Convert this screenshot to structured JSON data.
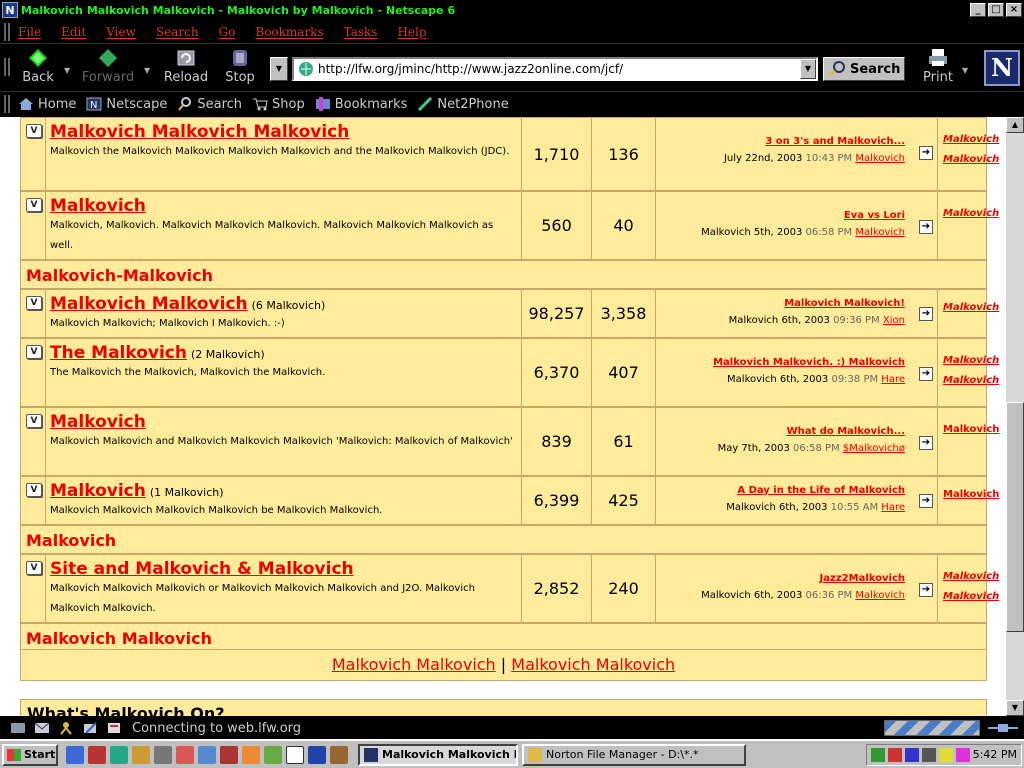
{
  "window": {
    "app_icon": "N",
    "title": "Malkovich Malkovich Malkovich - Malkovich by Malkovich - Netscape 6",
    "buttons": {
      "minimize": "_",
      "maximize": "□",
      "close": "×"
    }
  },
  "menu": [
    "File",
    "Edit",
    "View",
    "Search",
    "Go",
    "Bookmarks",
    "Tasks",
    "Help"
  ],
  "toolbar": {
    "back": "Back",
    "forward": "Forward",
    "reload": "Reload",
    "stop": "Stop",
    "url": "http://lfw.org/jminc/http://www.jazz2online.com/jcf/",
    "search": "Search",
    "print": "Print",
    "logo": "N"
  },
  "personal_toolbar": [
    "Home",
    "Netscape",
    "Search",
    "Shop",
    "Bookmarks",
    "Net2Phone"
  ],
  "forums": [
    {
      "title": "Malkovich Malkovich Malkovich",
      "count": "",
      "desc": "Malkovich the Malkovich Malkovich Malkovich Malkovich and the Malkovich Malkovich (JDC).",
      "posts": "1,710",
      "threads": "136",
      "last_topic": "3 on 3's and Malkovich...",
      "last_date": "July 22nd, 2003",
      "last_time": "10:43 PM",
      "last_by": "Malkovich",
      "mods": [
        "Malkovich",
        "Malkovich"
      ],
      "mods_italic": true
    },
    {
      "title": "Malkovich",
      "count": "",
      "desc": "Malkovich, Malkovich. Malkovich Malkovich Malkovich. Malkovich Malkovich Malkovich as well.",
      "posts": "560",
      "threads": "40",
      "last_topic": "Eva vs Lori",
      "last_date": "Malkovich 5th, 2003",
      "last_time": "06:58 PM",
      "last_by": "Malkovich",
      "mods": [
        "Malkovich"
      ],
      "mods_italic": true
    },
    {
      "title": "Malkovich Malkovich",
      "count": "(6 Malkovich)",
      "desc": "Malkovich Malkovich; Malkovich I Malkovich. :-)",
      "posts": "98,257",
      "threads": "3,358",
      "last_topic": "Malkovich Malkovich!",
      "last_date": "Malkovich 6th, 2003",
      "last_time": "09:36 PM",
      "last_by": "Xion",
      "mods": [
        "Malkovich"
      ],
      "mods_italic": true
    },
    {
      "title": "The Malkovich",
      "count": "(2 Malkovich)",
      "desc": "The Malkovich the Malkovich, Malkovich the Malkovich.",
      "posts": "6,370",
      "threads": "407",
      "last_topic": "Malkovich Malkovich. :) Malkovich",
      "last_date": "Malkovich 6th, 2003",
      "last_time": "09:38 PM",
      "last_by": "Hare",
      "mods": [
        "Malkovich",
        "Malkovich"
      ],
      "mods_italic": true
    },
    {
      "title": "Malkovich",
      "count": "",
      "desc": "Malkovich Malkovich and Malkovich Malkovich Malkovich 'Malkovich: Malkovich of Malkovich'",
      "posts": "839",
      "threads": "61",
      "last_topic": "What do Malkovich...",
      "last_date": "May 7th, 2003",
      "last_time": "06:58 PM",
      "last_by": "$Malkovichø",
      "mods": [
        "Malkovich"
      ],
      "mods_italic": false
    },
    {
      "title": "Malkovich",
      "count": "(1 Malkovich)",
      "desc": "Malkovich Malkovich Malkovich Malkovich be Malkovich Malkovich.",
      "posts": "6,399",
      "threads": "425",
      "last_topic": "A Day in the Life of Malkovich",
      "last_date": "Malkovich 6th, 2003",
      "last_time": "10:55 AM",
      "last_by": "Hare",
      "mods": [
        "Malkovich"
      ],
      "mods_italic": false
    },
    {
      "title": "Site and Malkovich & Malkovich",
      "count": "",
      "desc": "Malkovich Malkovich Malkovich or Malkovich Malkovich Malkovich and J2O. Malkovich Malkovich Malkovich.",
      "posts": "2,852",
      "threads": "240",
      "last_topic": "Jazz2Malkovich",
      "last_date": "Malkovich 6th, 2003",
      "last_time": "06:36 PM",
      "last_by": "Malkovich",
      "mods": [
        "Malkovich",
        "Malkovich"
      ],
      "mods_italic": true
    }
  ],
  "categories": [
    "Malkovich-Malkovich",
    "Malkovich",
    "Malkovich Malkovich"
  ],
  "footer_links": [
    "Malkovich Malkovich",
    "Malkovich Malkovich"
  ],
  "footer_sep": "|",
  "next_section": "What's Malkovich On?",
  "status": {
    "message": "Connecting to web.lfw.org"
  },
  "taskbar": {
    "start": "Start",
    "tasks": [
      "Malkovich Malkovich M...",
      "Norton File Manager - D:\\*.*"
    ],
    "clock": "5:42 PM"
  },
  "colors": {
    "link": "#e00000",
    "row_bg": "#ffeb99",
    "border": "#c8a868"
  }
}
